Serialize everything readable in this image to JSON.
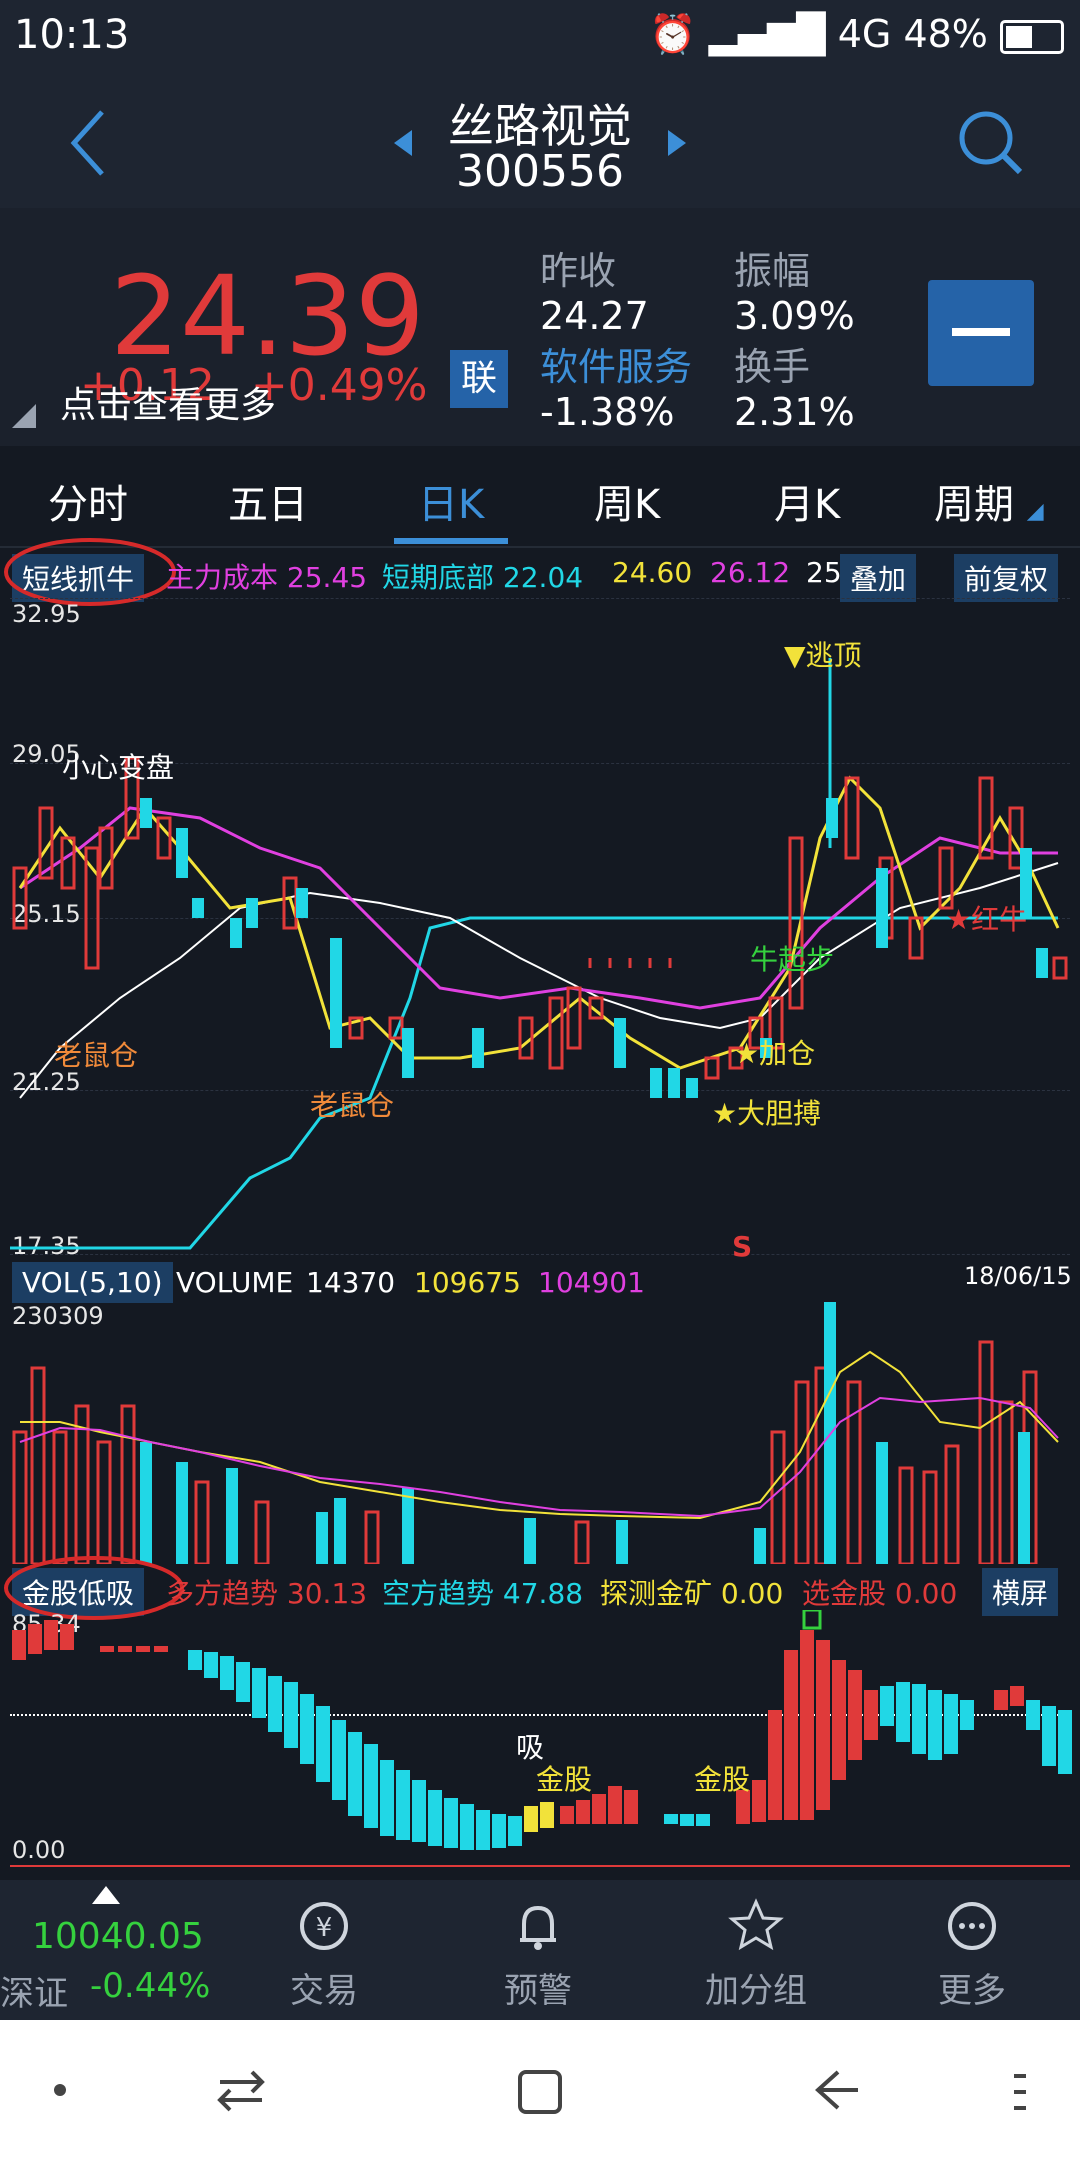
{
  "status_bar": {
    "time": "10:13",
    "network": "4G",
    "battery": "48%"
  },
  "header": {
    "title": "丝路视觉",
    "code": "300556"
  },
  "quote": {
    "price": "24.39",
    "change": "+0.12",
    "change_pct": "+0.49%",
    "tap_more": "点击查看更多",
    "badge": "联",
    "fields": [
      {
        "label": "昨收",
        "value": "24.27"
      },
      {
        "label": "振幅",
        "value": "3.09%"
      },
      {
        "label": "软件服务",
        "value": "-1.38%"
      },
      {
        "label": "换手",
        "value": "2.31%"
      }
    ]
  },
  "tabs": [
    "分时",
    "五日",
    "日K",
    "周K",
    "月K",
    "周期"
  ],
  "active_tab": "日K",
  "indicator_row": {
    "name": "短线抓牛",
    "main_cost_label": "主力成本",
    "main_cost_value": "25.45",
    "short_bottom_label": "短期底部",
    "short_bottom_value": "22.04",
    "v1": "24.60",
    "v2": "26.12",
    "v3": "25",
    "overlay_btn": "叠加",
    "adjust_btn": "前复权"
  },
  "main_chart": {
    "y_ticks": [
      "32.95",
      "29.05",
      "25.15",
      "21.25",
      "17.35"
    ],
    "annotations": {
      "escape_top": "▼逃顶",
      "careful": "小心变盘",
      "mouse1": "老鼠仓",
      "mouse2": "老鼠仓",
      "bull_start": "牛起步",
      "add_pos": "★加仓",
      "bold_bet": "★大胆搏",
      "red_bull": "★红牛",
      "s_mark": "S"
    }
  },
  "volume": {
    "label": "VOL(5,10)",
    "volume_label": "VOLUME",
    "volume_value": "14370",
    "ma5": "109675",
    "ma10": "104901",
    "date": "18/06/15",
    "y_top": "230309"
  },
  "indicator2": {
    "name": "金股低吸",
    "bull_label": "多方趋势",
    "bull_value": "30.13",
    "bear_label": "空方趋势",
    "bear_value": "47.88",
    "mine_label": "探测金矿",
    "mine_value": "0.00",
    "pick_label": "选金股",
    "pick_value": "0.00",
    "landscape_btn": "横屏",
    "y_top": "85.34",
    "y_bottom": "0.00",
    "tag_absorb": "吸",
    "tag_gold1": "金股",
    "tag_gold2": "金股"
  },
  "bottom_nav": {
    "index_value": "10040.05",
    "index_name": "深证",
    "index_change": "-0.44%",
    "items": [
      "交易",
      "预警",
      "加分组",
      "更多"
    ]
  },
  "colors": {
    "up": "#e03a3a",
    "down": "#21d7e6",
    "accent": "#3c8fd8"
  }
}
